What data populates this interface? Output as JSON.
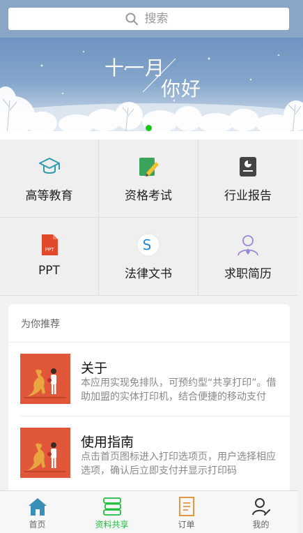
{
  "search": {
    "placeholder": "搜索"
  },
  "banner": {
    "line1": "十一月",
    "line2": "你好"
  },
  "categories": [
    {
      "label": "高等教育",
      "icon": "graduation-cap-icon"
    },
    {
      "label": "资格考试",
      "icon": "exam-pencil-icon"
    },
    {
      "label": "行业报告",
      "icon": "report-chart-icon"
    },
    {
      "label": "PPT",
      "icon": "ppt-file-icon",
      "icon_text": "PPT"
    },
    {
      "label": "法律文书",
      "icon": "legal-s-icon",
      "icon_text": "S"
    },
    {
      "label": "求职简历",
      "icon": "resume-person-icon"
    }
  ],
  "recommend": {
    "title": "为你推荐",
    "items": [
      {
        "title": "关于",
        "desc": "本应用实现免排队，可预约型“共享打印”。借助加盟的实体打印机，结合便捷的移动支付"
      },
      {
        "title": "使用指南",
        "desc": "点击首页图标进入打印选项页，用户选择相应选项，确认后立即支付并显示打印码"
      }
    ]
  },
  "tabbar": [
    {
      "label": "首页",
      "icon": "home-icon",
      "active": false
    },
    {
      "label": "资料共享",
      "icon": "books-icon",
      "active": true
    },
    {
      "label": "订单",
      "icon": "order-document-icon",
      "active": false
    },
    {
      "label": "我的",
      "icon": "user-edit-icon",
      "active": false
    }
  ],
  "colors": {
    "accent": "#1fbf3f",
    "banner_sky": "#6d93c0",
    "thumb_bg": "#e0573a"
  }
}
